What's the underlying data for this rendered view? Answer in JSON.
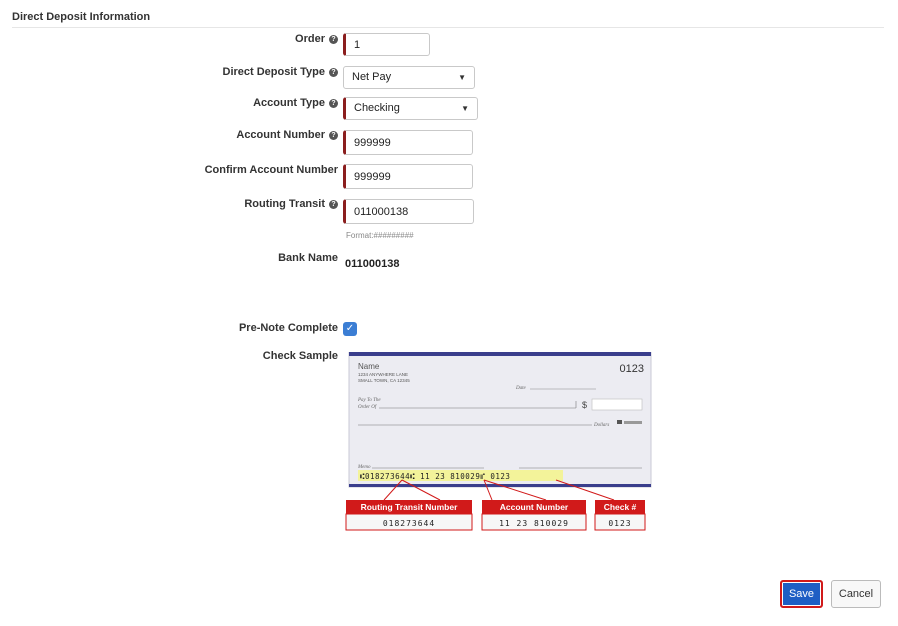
{
  "section": {
    "title": "Direct Deposit Information"
  },
  "form": {
    "order": {
      "label": "Order",
      "value": "1"
    },
    "deposit_type": {
      "label": "Direct Deposit Type",
      "value": "Net Pay"
    },
    "account_type": {
      "label": "Account Type",
      "value": "Checking"
    },
    "account_number": {
      "label": "Account Number",
      "value": "999999"
    },
    "confirm_account": {
      "label": "Confirm Account Number",
      "value": "999999"
    },
    "routing": {
      "label": "Routing Transit",
      "value": "011000138",
      "hint": "Format:#########"
    },
    "bank_name": {
      "label": "Bank Name",
      "value": "011000138"
    },
    "prenote": {
      "label": "Pre-Note Complete",
      "checked": true
    },
    "check_sample": {
      "label": "Check Sample"
    }
  },
  "check": {
    "name": "Name",
    "address1": "1234 ANYWHERE LANE",
    "address2": "SMALL TOWN, CA 12345",
    "number": "0123",
    "date_label": "Date",
    "pay_label1": "Pay To The",
    "pay_label2": "Order Of",
    "dollar_sign": "$",
    "dollars_label": "Dollars",
    "memo_label": "Memo",
    "micr_line": "⑆018273644⑆ 11 23 810029⑈ 0123",
    "routing_label": "Routing Transit Number",
    "routing_value": "018273644",
    "account_label": "Account Number",
    "account_value": "11 23 810029",
    "check_label": "Check #",
    "check_value": "0123"
  },
  "buttons": {
    "save": "Save",
    "cancel": "Cancel"
  },
  "colors": {
    "accent": "#1e5ec4",
    "required": "#8b1e1e",
    "callout": "#d11a1a"
  }
}
